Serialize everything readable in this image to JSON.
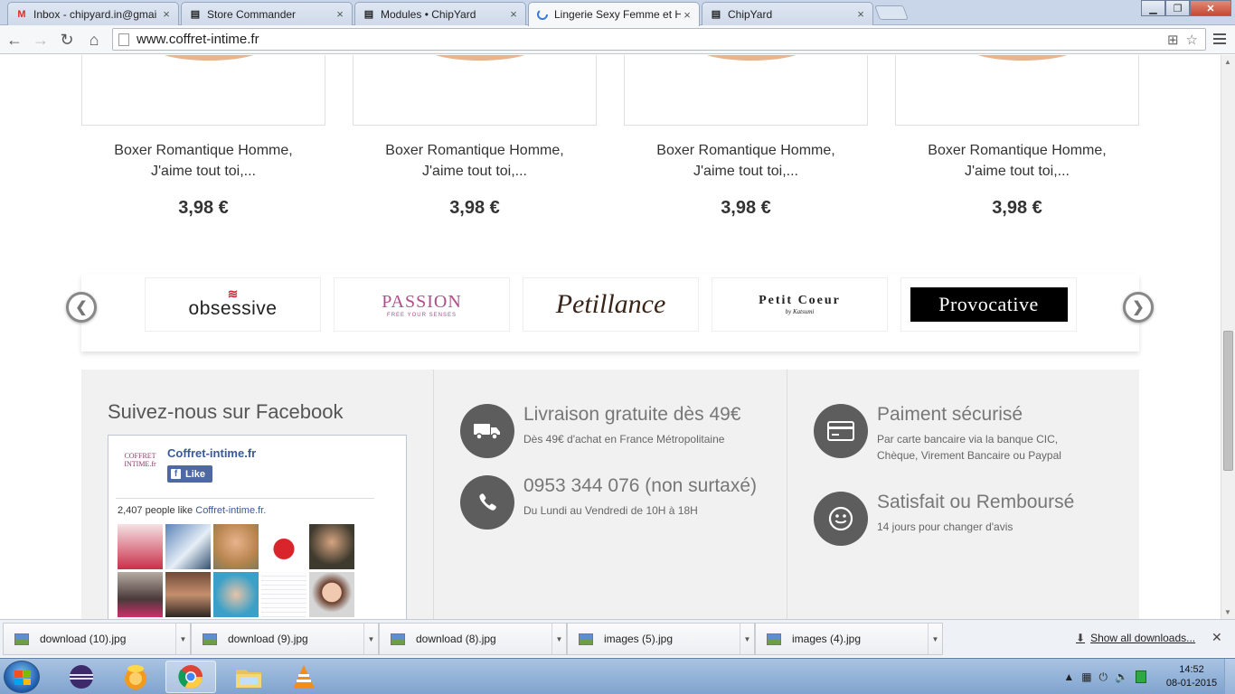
{
  "browser": {
    "tabs": [
      {
        "title": "Inbox - chipyard.in@gmai",
        "icon": "gmail-icon"
      },
      {
        "title": "Store Commander",
        "icon": "page-icon"
      },
      {
        "title": "Modules • ChipYard",
        "icon": "page-icon"
      },
      {
        "title": "Lingerie Sexy Femme et H",
        "icon": "loading-icon"
      },
      {
        "title": "ChipYard",
        "icon": "page-icon"
      }
    ],
    "url": "www.coffret-intime.fr"
  },
  "products": [
    {
      "name_line1": "Boxer Romantique Homme,",
      "name_line2": "J'aime tout toi,...",
      "price": "3,98 €"
    },
    {
      "name_line1": "Boxer Romantique Homme,",
      "name_line2": "J'aime tout toi,...",
      "price": "3,98 €"
    },
    {
      "name_line1": "Boxer Romantique Homme,",
      "name_line2": "J'aime tout toi,...",
      "price": "3,98 €"
    },
    {
      "name_line1": "Boxer Romantique Homme,",
      "name_line2": "J'aime tout toi,...",
      "price": "3,98 €"
    }
  ],
  "brands": [
    {
      "name": "obsessive"
    },
    {
      "name": "PASSION",
      "tagline": "FREE YOUR SENSES"
    },
    {
      "name": "Petillance"
    },
    {
      "name": "Petit Coeur",
      "tagline": "by Katsumi"
    },
    {
      "name": "Provocative"
    }
  ],
  "footer": {
    "facebook_title": "Suivez-nous sur Facebook",
    "fb": {
      "logo_text": "COFFRET INTIME.fr",
      "page_name": "Coffret-intime.fr",
      "like_label": "Like",
      "count_text": "2,407 people like",
      "count_link": "Coffret-intime.fr."
    },
    "features": [
      {
        "title": "Livraison gratuite dès 49€",
        "sub1": "Dès 49€ d'achat en France Métropolitaine",
        "sub2": ""
      },
      {
        "title": "0953 344 076 (non surtaxé)",
        "sub1": "Du Lundi au Vendredi de 10H à 18H",
        "sub2": ""
      },
      {
        "title": "Paiment sécurisé",
        "sub1": "Par carte bancaire via la banque CIC,",
        "sub2": "Chèque, Virement Bancaire ou Paypal"
      },
      {
        "title": "Satisfait ou Remboursé",
        "sub1": "14 jours pour changer d'avis",
        "sub2": ""
      }
    ]
  },
  "downloads": {
    "items": [
      "download (10).jpg",
      "download (9).jpg",
      "download (8).jpg",
      "images (5).jpg",
      "images (4).jpg"
    ],
    "show_all": "Show all downloads..."
  },
  "taskbar": {
    "time": "14:52",
    "date": "08-01-2015"
  },
  "colors": {
    "accent_dark": "#5d5d5d",
    "footer_bg": "#f1f1f1",
    "facebook_blue": "#3b5998"
  }
}
